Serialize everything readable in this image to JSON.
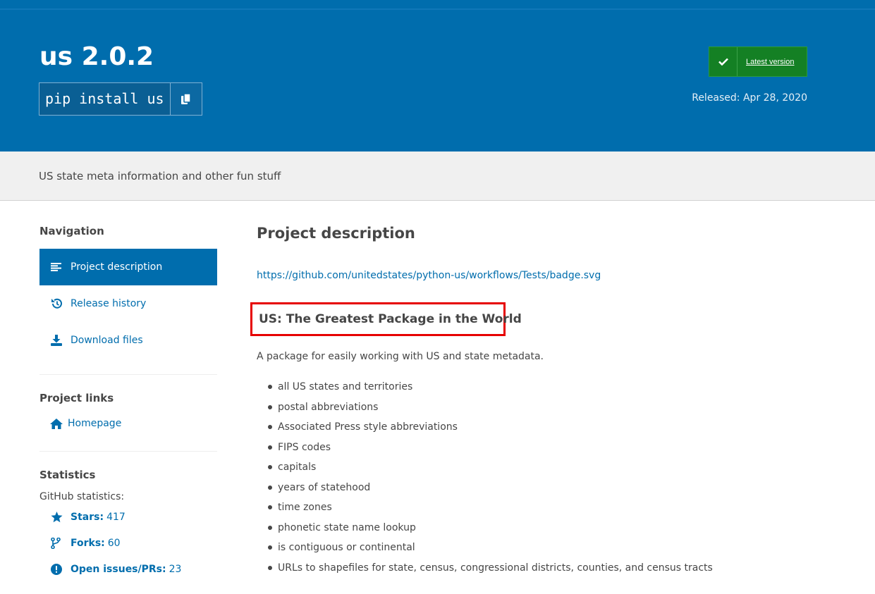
{
  "header": {
    "package_title": "us 2.0.2",
    "pip_command": "pip install us",
    "latest_version_label": "Latest version",
    "released_label": "Released: Apr 28, 2020"
  },
  "summary": "US state meta information and other fun stuff",
  "sidebar": {
    "navigation_heading": "Navigation",
    "nav_items": [
      {
        "label": "Project description",
        "icon": "align-left-icon",
        "active": true
      },
      {
        "label": "Release history",
        "icon": "history-icon",
        "active": false
      },
      {
        "label": "Download files",
        "icon": "download-icon",
        "active": false
      }
    ],
    "project_links_heading": "Project links",
    "homepage_label": "Homepage",
    "statistics_heading": "Statistics",
    "github_stats_label": "GitHub statistics:",
    "stats": [
      {
        "label": "Stars:",
        "value": "417",
        "icon": "star-icon"
      },
      {
        "label": "Forks:",
        "value": "60",
        "icon": "fork-icon"
      },
      {
        "label": "Open issues/PRs:",
        "value": "23",
        "icon": "alert-icon"
      }
    ]
  },
  "main": {
    "section_title": "Project description",
    "badge_link": "https://github.com/unitedstates/python-us/workflows/Tests/badge.svg",
    "readme_heading": "US: The Greatest Package in the World",
    "readme_intro": "A package for easily working with US and state metadata.",
    "features": [
      "all US states and territories",
      "postal abbreviations",
      "Associated Press style abbreviations",
      "FIPS codes",
      "capitals",
      "years of statehood",
      "time zones",
      "phonetic state name lookup",
      "is contiguous or continental",
      "URLs to shapefiles for state, census, congressional districts, counties, and census tracts"
    ]
  },
  "colors": {
    "brand_blue": "#006dad",
    "success_green": "#148024",
    "highlight_red": "#e60000"
  }
}
